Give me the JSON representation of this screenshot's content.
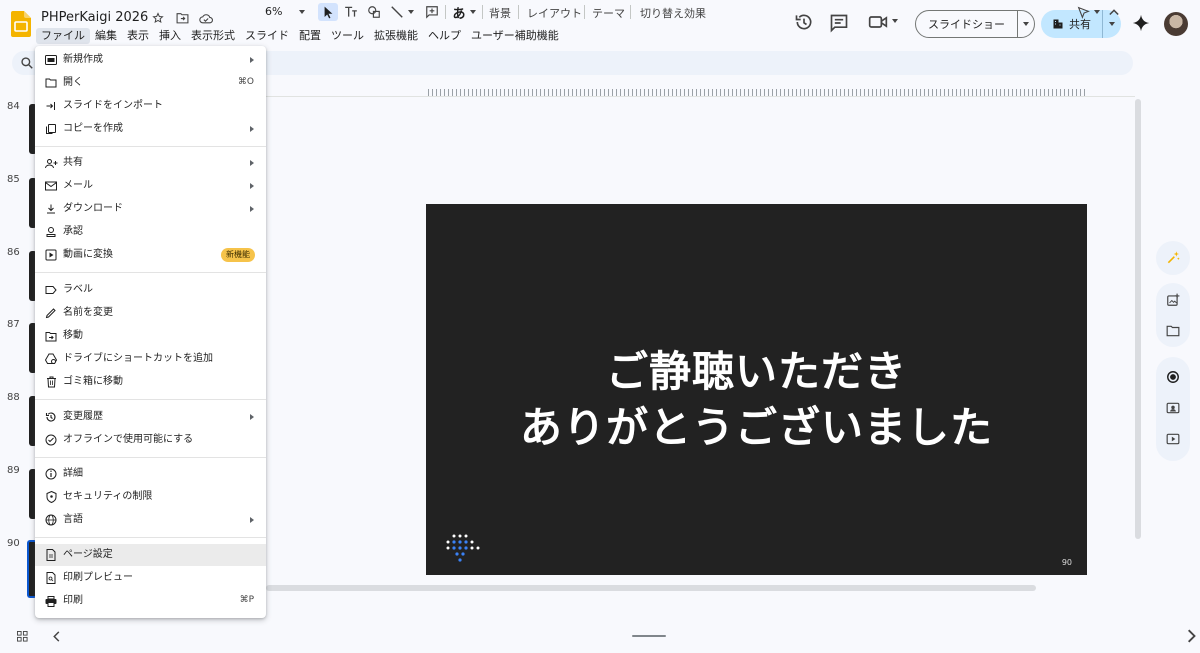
{
  "app": {
    "title": "PHPerKaigi 2026",
    "menus": [
      "ファイル",
      "編集",
      "表示",
      "挿入",
      "表示形式",
      "スライド",
      "配置",
      "ツール",
      "拡張機能",
      "ヘルプ",
      "ユーザー補助機能"
    ],
    "slideshow_label": "スライドショー",
    "share_label": "共有"
  },
  "toolbar": {
    "zoom": "6%",
    "background": "背景",
    "layout": "レイアウト",
    "theme": "テーマ",
    "transition": "切り替え効果",
    "input_mode": "あ"
  },
  "filmstrip": {
    "slide_numbers": [
      "84",
      "85",
      "86",
      "87",
      "88",
      "89",
      "90"
    ]
  },
  "slide": {
    "line1": "ご静聴いただき",
    "line2": "ありがとうございました",
    "number": "90"
  },
  "file_menu": {
    "new": "新規作成",
    "open": "開く",
    "open_shortcut": "⌘O",
    "import_slides": "スライドをインポート",
    "make_copy": "コピーを作成",
    "share": "共有",
    "email": "メール",
    "download": "ダウンロード",
    "approvals": "承認",
    "convert_to_video": "動画に変換",
    "new_badge": "新機能",
    "labels": "ラベル",
    "rename": "名前を変更",
    "move": "移動",
    "add_shortcut": "ドライブにショートカットを追加",
    "move_to_trash": "ゴミ箱に移動",
    "version_history": "変更履歴",
    "make_offline": "オフラインで使用可能にする",
    "details": "詳細",
    "security_limitations": "セキュリティの制限",
    "language": "言語",
    "page_setup": "ページ設定",
    "print_preview": "印刷プレビュー",
    "print": "印刷",
    "print_shortcut": "⌘P"
  },
  "colors": {
    "slide_bg": "#222222",
    "accent": "#0b57d0",
    "share_bg": "#c2e7ff",
    "badge": "#f6c34a"
  }
}
